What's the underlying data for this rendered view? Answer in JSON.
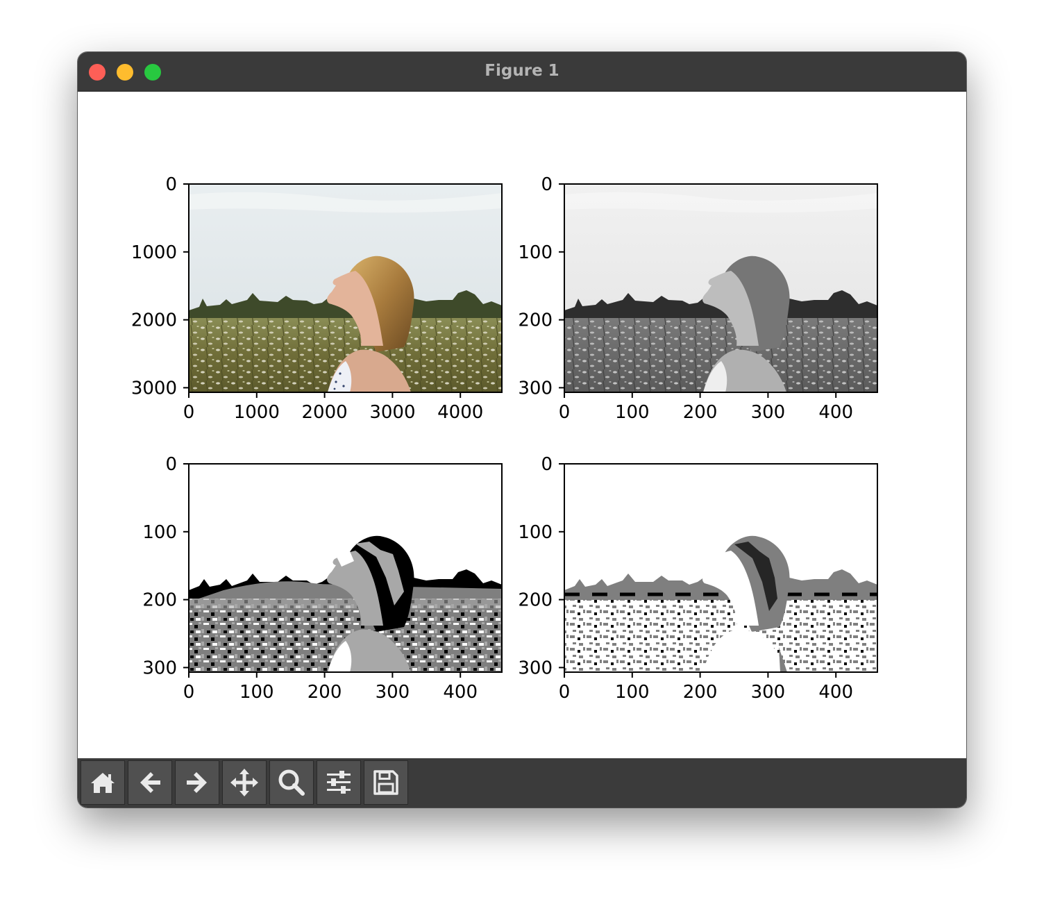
{
  "window": {
    "title": "Figure 1"
  },
  "traffic_lights": {
    "close": "#fe5f57",
    "minimize": "#febc2e",
    "maximize": "#28c840"
  },
  "toolbar": {
    "buttons": [
      {
        "name": "home",
        "icon": "home-icon"
      },
      {
        "name": "back",
        "icon": "arrow-left-icon"
      },
      {
        "name": "forward",
        "icon": "arrow-right-icon"
      },
      {
        "name": "pan",
        "icon": "move-icon"
      },
      {
        "name": "zoom",
        "icon": "magnifier-icon"
      },
      {
        "name": "configure-subplots",
        "icon": "sliders-icon"
      },
      {
        "name": "save",
        "icon": "floppy-disk-icon"
      }
    ]
  },
  "figure": {
    "subplots": [
      {
        "id": "original-color",
        "content": "color photograph, woman in field",
        "xticks": [
          "0",
          "1000",
          "2000",
          "3000",
          "4000"
        ],
        "yticks": [
          "0",
          "1000",
          "2000",
          "3000"
        ]
      },
      {
        "id": "grayscale",
        "content": "grayscale image",
        "xticks": [
          "0",
          "100",
          "200",
          "300",
          "400"
        ],
        "yticks": [
          "0",
          "100",
          "200",
          "300"
        ]
      },
      {
        "id": "quantized-4-levels",
        "content": "posterized image, 4 gray levels",
        "xticks": [
          "0",
          "100",
          "200",
          "300",
          "400"
        ],
        "yticks": [
          "0",
          "100",
          "200",
          "300"
        ]
      },
      {
        "id": "quantized-3-levels",
        "content": "posterized image, 3 gray levels",
        "xticks": [
          "0",
          "100",
          "200",
          "300",
          "400"
        ],
        "yticks": [
          "0",
          "100",
          "200",
          "300"
        ]
      }
    ]
  }
}
